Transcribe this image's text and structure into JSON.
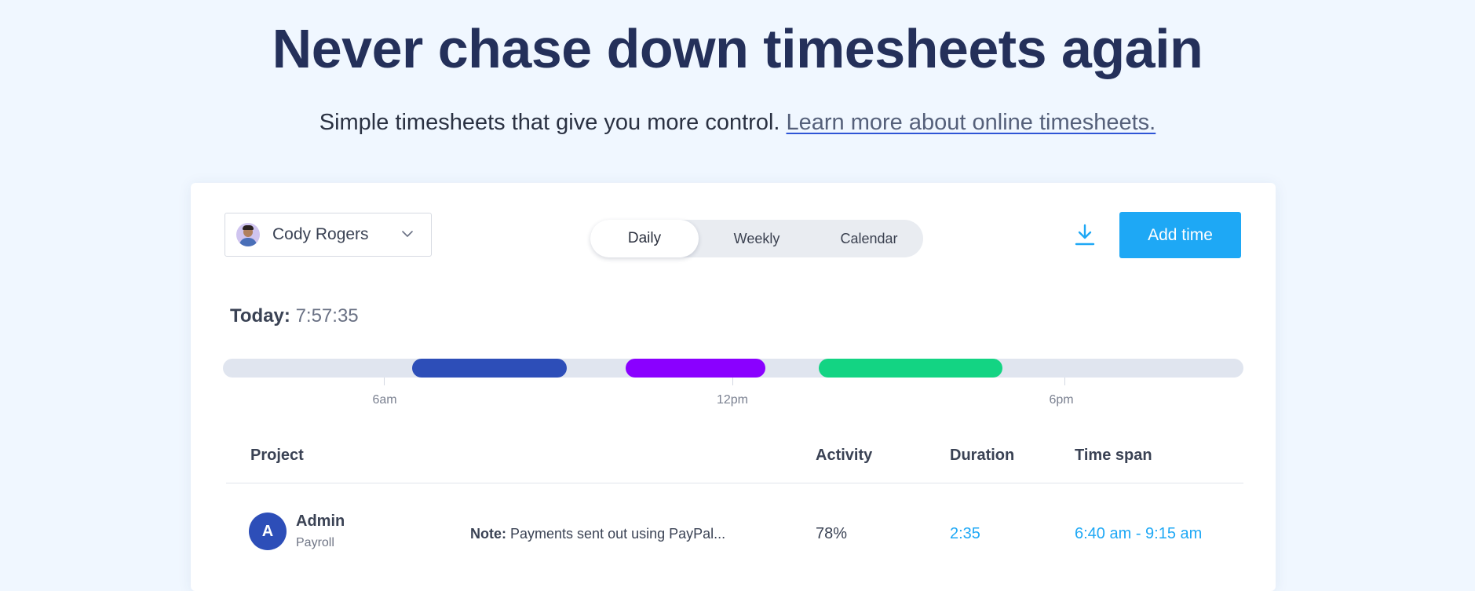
{
  "hero": {
    "title": "Never chase down timesheets again",
    "subtitle": "Simple timesheets that give you more control.",
    "link_text": "Learn more about online timesheets."
  },
  "toolbar": {
    "user_name": "Cody Rogers",
    "tabs": [
      {
        "label": "Daily",
        "active": true
      },
      {
        "label": "Weekly",
        "active": false
      },
      {
        "label": "Calendar",
        "active": false
      }
    ],
    "download_icon": "download-icon",
    "add_time_label": "Add time"
  },
  "summary": {
    "today_label": "Today:",
    "today_value": "7:57:35"
  },
  "timeline": {
    "tick_labels": [
      "6am",
      "12pm",
      "6pm"
    ],
    "segment_colors": [
      "#2d4eb8",
      "#8a00ff",
      "#13d483"
    ]
  },
  "table": {
    "headers": {
      "project": "Project",
      "activity": "Activity",
      "duration": "Duration",
      "time_span": "Time span"
    },
    "rows": [
      {
        "initial": "A",
        "project": "Admin",
        "subproject": "Payroll",
        "note_label": "Note:",
        "note_text": "Payments sent out using PayPal...",
        "activity": "78%",
        "duration": "2:35",
        "time_span": "6:40 am - 9:15 am"
      }
    ]
  },
  "colors": {
    "accent": "#1ea8f5",
    "title": "#24305a",
    "link_underline": "#2e55d6",
    "background": "#f0f7ff"
  }
}
